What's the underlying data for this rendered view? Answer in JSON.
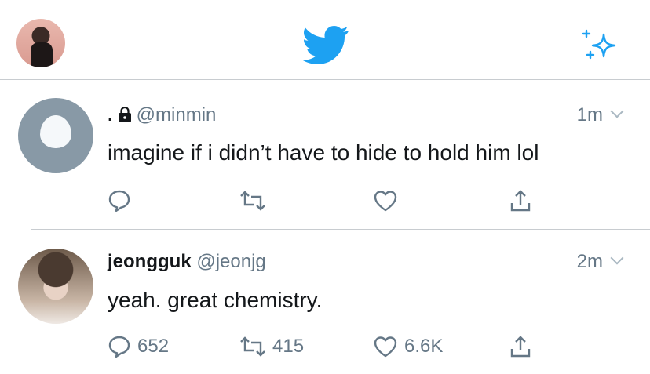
{
  "tweets": [
    {
      "display_name": ".",
      "handle": "@minmin",
      "protected": true,
      "time": "1m",
      "text": "imagine if i didn’t have to hide to hold him lol",
      "counts": {
        "reply": "",
        "retweet": "",
        "like": ""
      }
    },
    {
      "display_name": "jeongguk",
      "handle": "@jeonjg",
      "protected": false,
      "time": "2m",
      "text": "yeah. great chemistry.",
      "counts": {
        "reply": "652",
        "retweet": "415",
        "like": "6.6K"
      }
    }
  ],
  "colors": {
    "twitter_blue": "#1da1f2",
    "muted": "#657786",
    "divider": "#c8ccd0",
    "egg_bg": "#8899a6"
  },
  "icons": [
    "profile-avatar",
    "twitter-bird-icon",
    "sparkle-icon",
    "lock-icon",
    "chevron-down-icon",
    "reply-icon",
    "retweet-icon",
    "like-icon",
    "share-icon"
  ]
}
